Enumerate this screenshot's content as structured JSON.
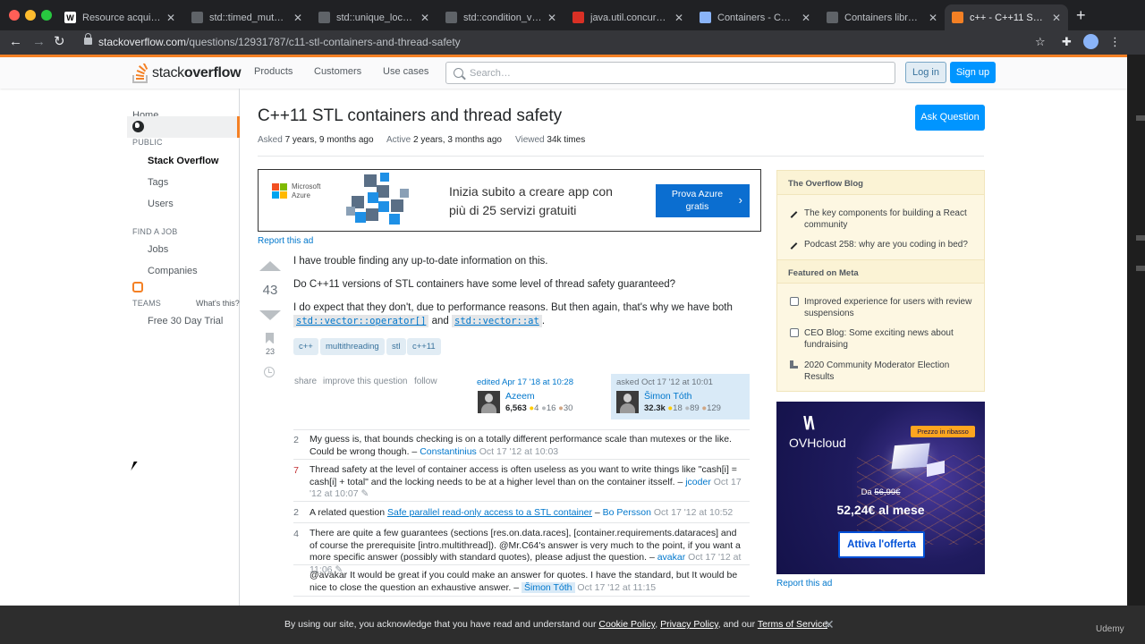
{
  "browser": {
    "tabs": [
      {
        "title": "Resource acquisition",
        "fav": "W",
        "fav_color": "#ffffff",
        "fav_text": "#000000"
      },
      {
        "title": "std::timed_mutex - c",
        "fav": "",
        "fav_color": "#5f6368",
        "fav_text": "#ffffff"
      },
      {
        "title": "std::unique_lock - cp",
        "fav": "",
        "fav_color": "#5f6368",
        "fav_text": "#ffffff"
      },
      {
        "title": "std::condition_variab",
        "fav": "",
        "fav_color": "#5f6368",
        "fav_text": "#ffffff"
      },
      {
        "title": "java.util.concurrent (",
        "fav": "",
        "fav_color": "#d93025",
        "fav_text": "#ffffff"
      },
      {
        "title": "Containers - C++ Re",
        "fav": "",
        "fav_color": "#8ab4f8",
        "fav_text": "#000000"
      },
      {
        "title": "Containers library - c",
        "fav": "",
        "fav_color": "#5f6368",
        "fav_text": "#ffffff"
      },
      {
        "title": "c++ - C++11 STL con",
        "fav": "",
        "fav_color": "#f48024",
        "fav_text": "#ffffff",
        "active": true
      }
    ],
    "url_host": "stackoverflow.com",
    "url_path": "/questions/12931787/c11-stl-containers-and-thread-safety"
  },
  "header": {
    "logo_text_1": "stack",
    "logo_text_2": "overflow",
    "nav": [
      "Products",
      "Customers",
      "Use cases"
    ],
    "search_placeholder": "Search…",
    "login": "Log in",
    "signup": "Sign up"
  },
  "leftnav": {
    "home": "Home",
    "public_head": "PUBLIC",
    "stack_overflow": "Stack Overflow",
    "tags": "Tags",
    "users": "Users",
    "find_job_head": "FIND A JOB",
    "jobs": "Jobs",
    "companies": "Companies",
    "teams_head": "TEAMS",
    "whats_this": "What's this?",
    "trial": "Free 30 Day Trial"
  },
  "question": {
    "title": "C++11 STL containers and thread safety",
    "ask_button": "Ask Question",
    "asked_label": "Asked",
    "asked_value": "7 years, 9 months ago",
    "active_label": "Active",
    "active_value": "2 years, 3 months ago",
    "viewed_label": "Viewed",
    "viewed_value": "34k times",
    "votes": "43",
    "bookmarks": "23",
    "body_1": "I have trouble finding any up-to-date information on this.",
    "body_2": "Do C++11 versions of STL containers have some level of thread safety guaranteed?",
    "body_3a": "I do expect that they don't, due to performance reasons. But then again, that's why we have both",
    "code_1": "std::vector::operator[]",
    "body_3b": "and",
    "code_2": "std::vector::at",
    "body_3c": ".",
    "tags": [
      "c++",
      "multithreading",
      "stl",
      "c++11"
    ],
    "menu": [
      "share",
      "improve this question",
      "follow"
    ],
    "edited": "edited Apr 17 '18 at 10:28",
    "editor": {
      "name": "Azeem",
      "rep": "6,563",
      "gold": "4",
      "silver": "16",
      "bronze": "30"
    },
    "asked": "asked Oct 17 '12 at 10:01",
    "asker": {
      "name": "Šimon Tóth",
      "rep": "32.3k",
      "gold": "18",
      "silver": "89",
      "bronze": "129"
    }
  },
  "ad": {
    "brand_1": "Microsoft",
    "brand_2": "Azure",
    "text_1": "Inizia subito a creare app con",
    "text_2": "più di 25 servizi gratuiti",
    "button_1": "Prova Azure",
    "button_2": "gratis",
    "report": "Report this ad"
  },
  "comments": [
    {
      "score": "2",
      "hot": false,
      "text": "My guess is, that bounds checking is on a totally different performance scale than mutexes or the like. Could be wrong though. –",
      "user": "Constantinius",
      "date": "Oct 17 '12 at 10:03"
    },
    {
      "score": "7",
      "hot": true,
      "text": "Thread safety at the level of container access is often useless as you want to write things like \"cash[i] = cash[i] + total\" and the locking needs to be at a higher level than on the container itsself. –",
      "user": "jcoder",
      "date": "Oct 17 '12 at 10:07"
    },
    {
      "score": "2",
      "hot": false,
      "text_pre": "A related question",
      "link": "Safe parallel read-only access to a STL container",
      "text": "–",
      "user": "Bo Persson",
      "date": "Oct 17 '12 at 10:52"
    },
    {
      "score": "4",
      "hot": false,
      "text": "There are quite a few guarantees (sections [res.on.data.races], [container.requirements.dataraces] and of course the prerequisite [intro.multithread]). @Mr.C64's answer is very much to the point, if you want a more specific answer (possibly with standard quotes), please adjust the question. –",
      "user": "avakar",
      "date": "Oct 17 '12 at 11:06"
    },
    {
      "score": "",
      "hot": false,
      "text": "@avakar It would be great if you could make an answer for quotes. I have the standard, but It would be nice to close the question an exhaustive answer. –",
      "user": "Šimon Tóth",
      "op": true,
      "date": "Oct 17 '12 at 11:15"
    }
  ],
  "sidebar": {
    "blog_head": "The Overflow Blog",
    "blog_items": [
      "The key components for building a React community",
      "Podcast 258: why are you coding in bed?"
    ],
    "meta_head": "Featured on Meta",
    "meta_items": [
      "Improved experience for users with review suspensions",
      "CEO Blog: Some exciting news about fundraising",
      "2020 Community Moderator Election Results"
    ]
  },
  "ovh": {
    "logo": "OVHcloud",
    "badge": "Prezzo in ribasso",
    "old_label": "Da",
    "old_price": "56,99€",
    "price": "52,24€ al mese",
    "button": "Attiva l'offerta",
    "report": "Report this ad"
  },
  "cookie": {
    "text_1": "By using our site, you acknowledge that you have read and understand our",
    "link_1": "Cookie Policy",
    "sep_1": ",",
    "link_2": "Privacy Policy",
    "sep_2": ", and our",
    "link_3": "Terms of Service",
    "end": "."
  },
  "watermark": "Udemy"
}
